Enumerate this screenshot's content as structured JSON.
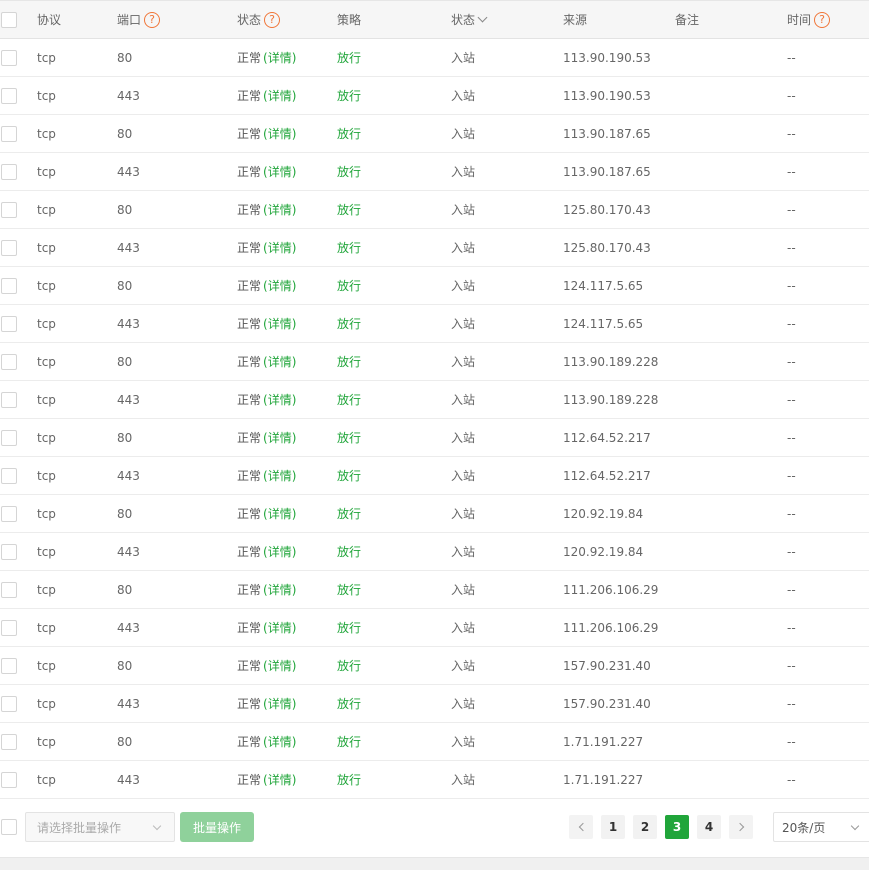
{
  "header": {
    "protocol": "协议",
    "port": "端口",
    "status": "状态",
    "policy": "策略",
    "direction": "状态",
    "source": "来源",
    "remark": "备注",
    "time": "时间",
    "help_glyph": "?"
  },
  "rows": [
    {
      "protocol": "tcp",
      "port": "80",
      "status": "正常",
      "detail": "(详情)",
      "policy": "放行",
      "direction": "入站",
      "source": "113.90.190.53",
      "remark": "",
      "time": "--"
    },
    {
      "protocol": "tcp",
      "port": "443",
      "status": "正常",
      "detail": "(详情)",
      "policy": "放行",
      "direction": "入站",
      "source": "113.90.190.53",
      "remark": "",
      "time": "--"
    },
    {
      "protocol": "tcp",
      "port": "80",
      "status": "正常",
      "detail": "(详情)",
      "policy": "放行",
      "direction": "入站",
      "source": "113.90.187.65",
      "remark": "",
      "time": "--"
    },
    {
      "protocol": "tcp",
      "port": "443",
      "status": "正常",
      "detail": "(详情)",
      "policy": "放行",
      "direction": "入站",
      "source": "113.90.187.65",
      "remark": "",
      "time": "--"
    },
    {
      "protocol": "tcp",
      "port": "80",
      "status": "正常",
      "detail": "(详情)",
      "policy": "放行",
      "direction": "入站",
      "source": "125.80.170.43",
      "remark": "",
      "time": "--"
    },
    {
      "protocol": "tcp",
      "port": "443",
      "status": "正常",
      "detail": "(详情)",
      "policy": "放行",
      "direction": "入站",
      "source": "125.80.170.43",
      "remark": "",
      "time": "--"
    },
    {
      "protocol": "tcp",
      "port": "80",
      "status": "正常",
      "detail": "(详情)",
      "policy": "放行",
      "direction": "入站",
      "source": "124.117.5.65",
      "remark": "",
      "time": "--"
    },
    {
      "protocol": "tcp",
      "port": "443",
      "status": "正常",
      "detail": "(详情)",
      "policy": "放行",
      "direction": "入站",
      "source": "124.117.5.65",
      "remark": "",
      "time": "--"
    },
    {
      "protocol": "tcp",
      "port": "80",
      "status": "正常",
      "detail": "(详情)",
      "policy": "放行",
      "direction": "入站",
      "source": "113.90.189.228",
      "remark": "",
      "time": "--"
    },
    {
      "protocol": "tcp",
      "port": "443",
      "status": "正常",
      "detail": "(详情)",
      "policy": "放行",
      "direction": "入站",
      "source": "113.90.189.228",
      "remark": "",
      "time": "--"
    },
    {
      "protocol": "tcp",
      "port": "80",
      "status": "正常",
      "detail": "(详情)",
      "policy": "放行",
      "direction": "入站",
      "source": "112.64.52.217",
      "remark": "",
      "time": "--"
    },
    {
      "protocol": "tcp",
      "port": "443",
      "status": "正常",
      "detail": "(详情)",
      "policy": "放行",
      "direction": "入站",
      "source": "112.64.52.217",
      "remark": "",
      "time": "--"
    },
    {
      "protocol": "tcp",
      "port": "80",
      "status": "正常",
      "detail": "(详情)",
      "policy": "放行",
      "direction": "入站",
      "source": "120.92.19.84",
      "remark": "",
      "time": "--"
    },
    {
      "protocol": "tcp",
      "port": "443",
      "status": "正常",
      "detail": "(详情)",
      "policy": "放行",
      "direction": "入站",
      "source": "120.92.19.84",
      "remark": "",
      "time": "--"
    },
    {
      "protocol": "tcp",
      "port": "80",
      "status": "正常",
      "detail": "(详情)",
      "policy": "放行",
      "direction": "入站",
      "source": "111.206.106.29",
      "remark": "",
      "time": "--"
    },
    {
      "protocol": "tcp",
      "port": "443",
      "status": "正常",
      "detail": "(详情)",
      "policy": "放行",
      "direction": "入站",
      "source": "111.206.106.29",
      "remark": "",
      "time": "--"
    },
    {
      "protocol": "tcp",
      "port": "80",
      "status": "正常",
      "detail": "(详情)",
      "policy": "放行",
      "direction": "入站",
      "source": "157.90.231.40",
      "remark": "",
      "time": "--"
    },
    {
      "protocol": "tcp",
      "port": "443",
      "status": "正常",
      "detail": "(详情)",
      "policy": "放行",
      "direction": "入站",
      "source": "157.90.231.40",
      "remark": "",
      "time": "--"
    },
    {
      "protocol": "tcp",
      "port": "80",
      "status": "正常",
      "detail": "(详情)",
      "policy": "放行",
      "direction": "入站",
      "source": "1.71.191.227",
      "remark": "",
      "time": "--"
    },
    {
      "protocol": "tcp",
      "port": "443",
      "status": "正常",
      "detail": "(详情)",
      "policy": "放行",
      "direction": "入站",
      "source": "1.71.191.227",
      "remark": "",
      "time": "--"
    }
  ],
  "footer": {
    "batch_placeholder": "请选择批量操作",
    "batch_button": "批量操作",
    "pages": [
      "1",
      "2",
      "3",
      "4"
    ],
    "current_page": "3",
    "page_size": "20条/页"
  },
  "colors": {
    "accent": "#20a53a",
    "help_icon": "#f0773a"
  },
  "icons": {
    "help": "question-circle-icon",
    "sort": "chevron-down-icon",
    "prev": "chevron-left-icon",
    "next": "chevron-right-icon"
  }
}
